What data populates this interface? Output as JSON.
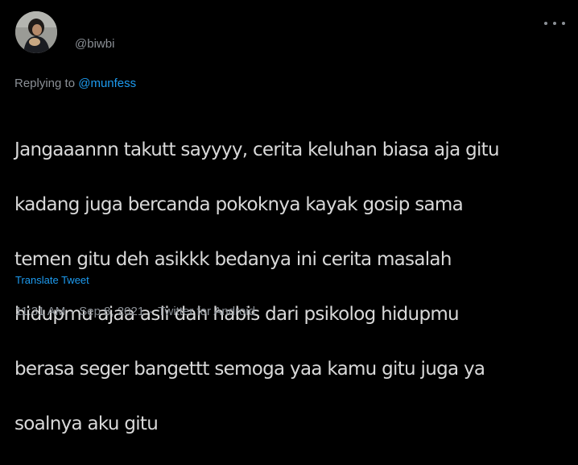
{
  "tweet": {
    "author": {
      "handle": "@biwbi"
    },
    "more_icon": "more-dots-icon",
    "replying": {
      "prefix": "Replying to ",
      "to": "@munfess"
    },
    "lines": [
      "Jangaaannn takutt sayyyy, cerita keluhan biasa aja gitu",
      "kadang juga bercanda pokoknya kayak gosip sama",
      "temen gitu deh asikkk bedanya ini cerita masalah",
      "hidupmu ajaa asli dah habis dari psikolog hidupmu",
      "berasa seger bangettt semoga yaa kamu gitu juga ya",
      "soalnya aku gitu"
    ],
    "translate_label": "Translate Tweet",
    "meta": {
      "time": "11:31 AM",
      "separator": "·",
      "date": "Sep 8, 2021",
      "source": "Twitter for Android"
    }
  },
  "colors": {
    "background": "#000000",
    "text": "#d9d9d9",
    "secondary": "#8b9096",
    "link": "#1d9bf0"
  }
}
